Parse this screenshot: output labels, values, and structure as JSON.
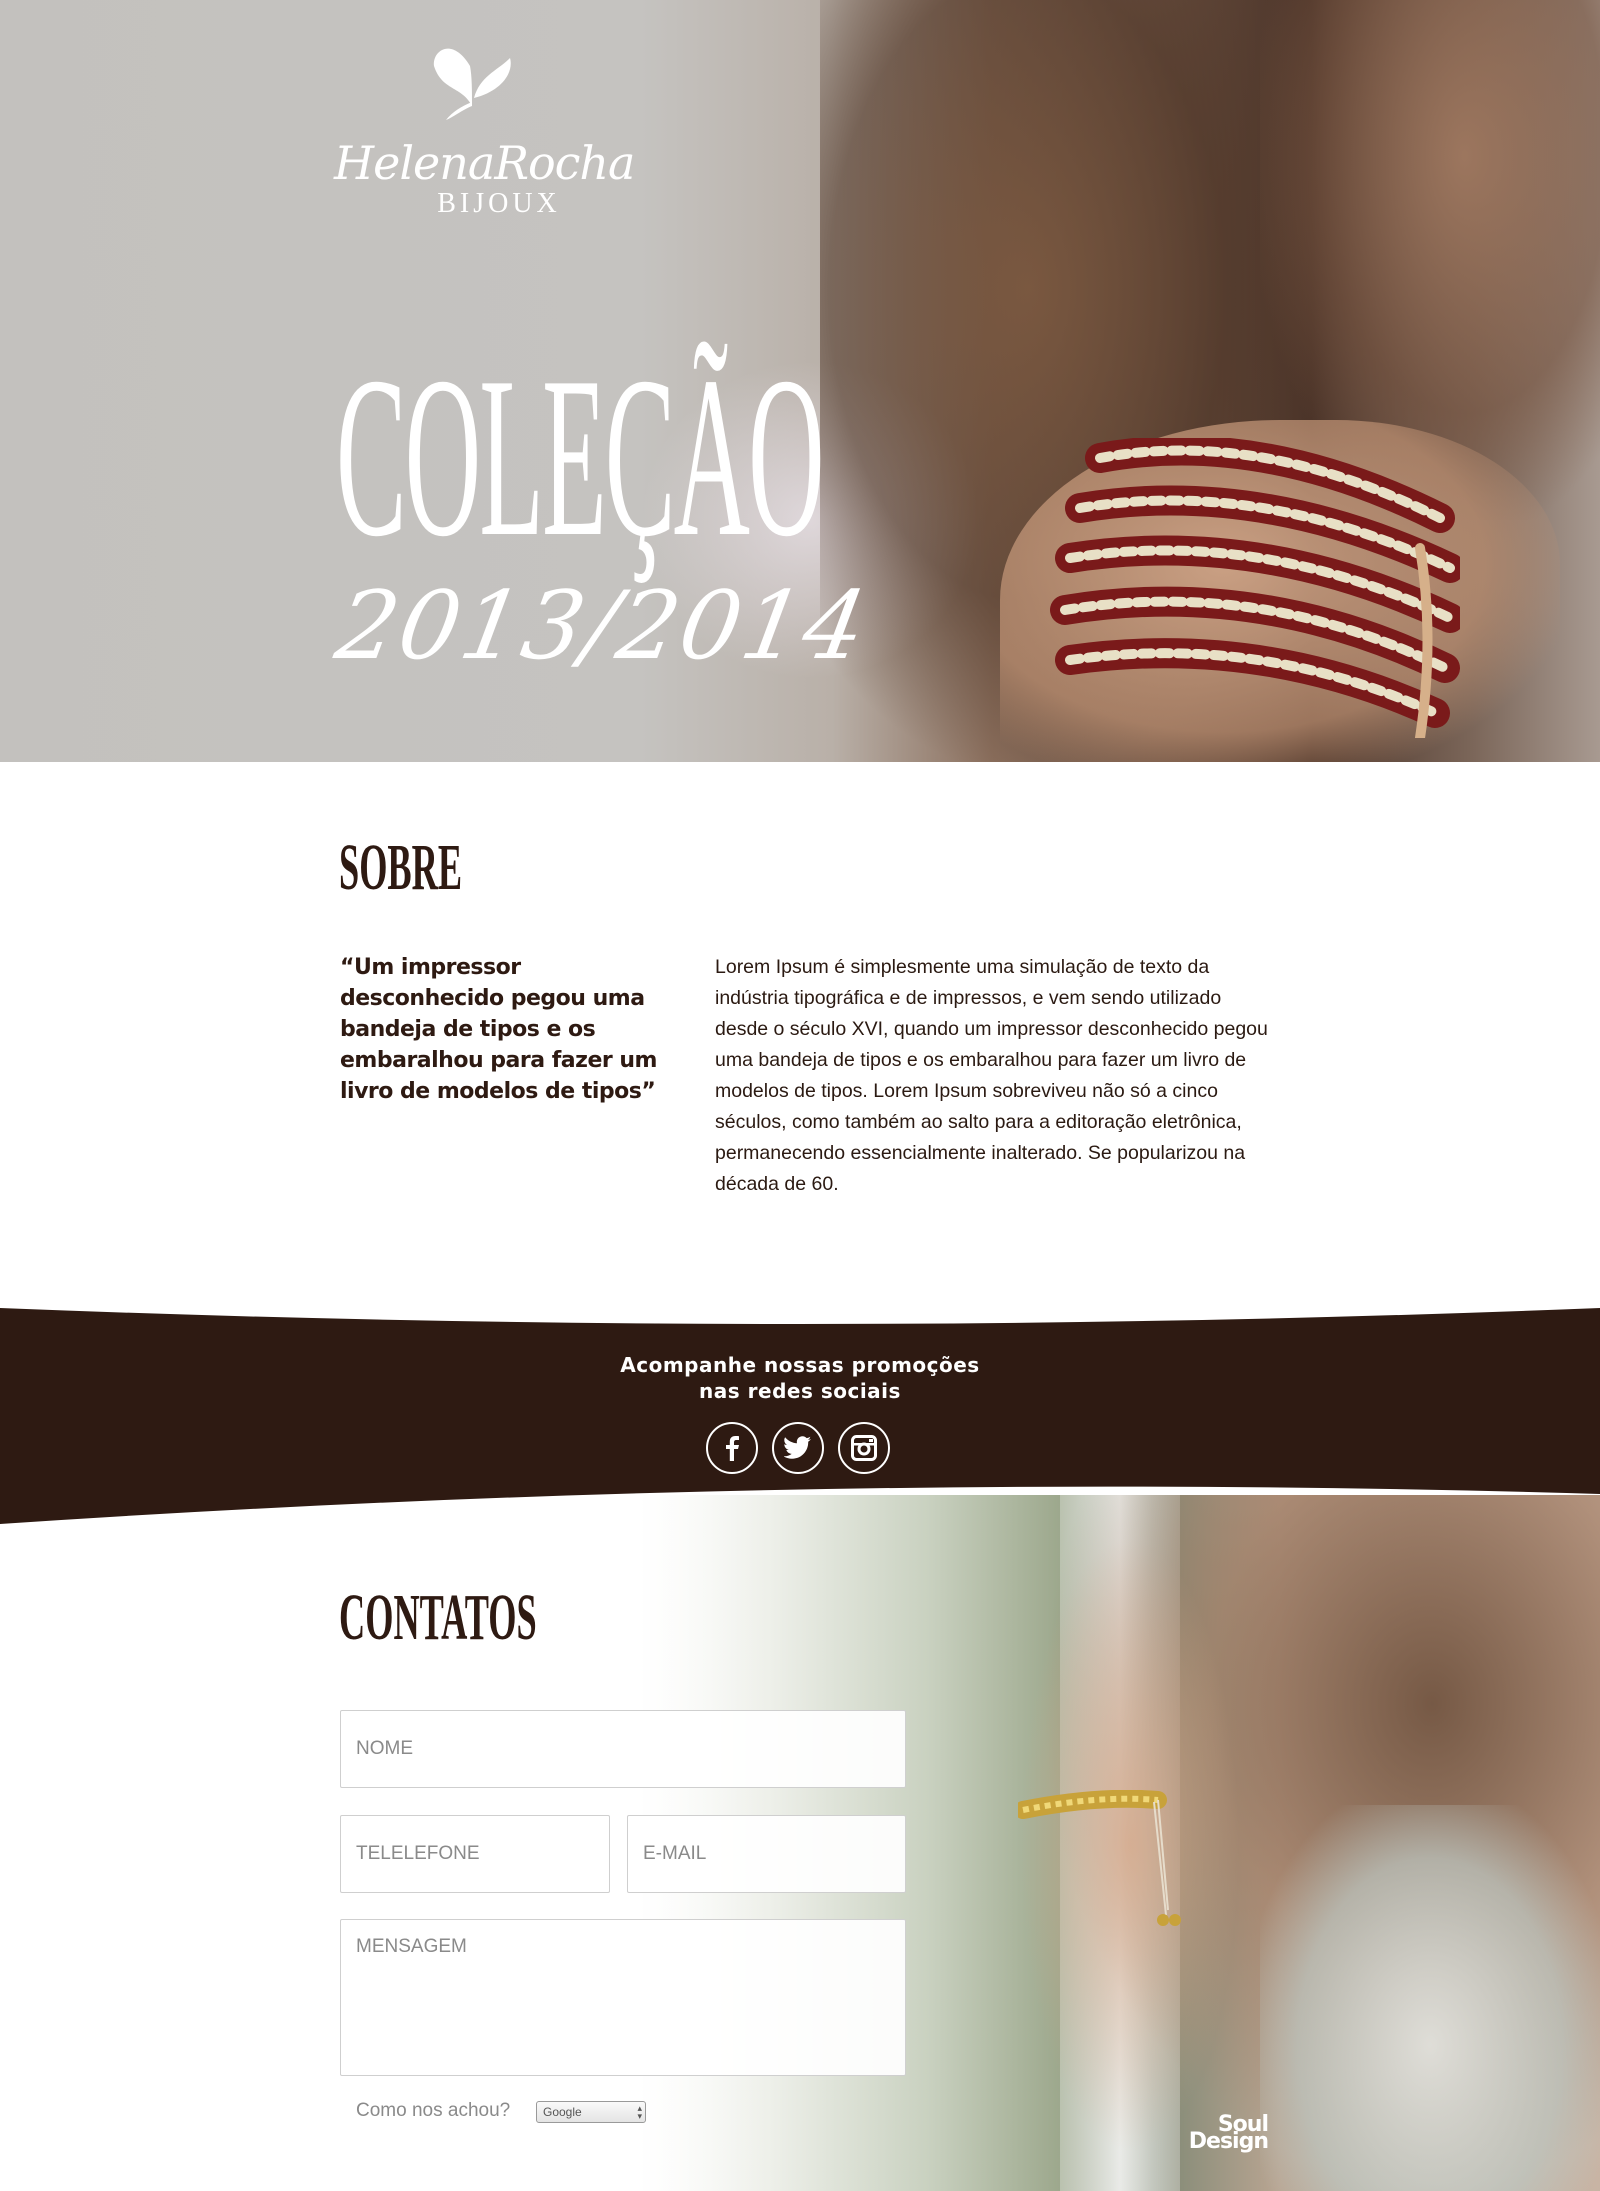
{
  "brand": {
    "name": "HelenaRocha",
    "sub": "BIJOUX"
  },
  "hero": {
    "title": "COLEÇÃO",
    "year": "2013/2014"
  },
  "sobre": {
    "title": "SOBRE",
    "quote": "“Um impressor desconhecido pegou uma bandeja de tipos e os embaralhou para fazer um livro de modelos de tipos”",
    "text": "Lorem Ipsum é simplesmente uma simulação de texto da indústria tipográfica e de impressos, e vem sendo utilizado desde o século XVI, quando um impressor desconhecido pegou uma bandeja de tipos e os embaralhou para fazer um livro de modelos de tipos. Lorem Ipsum sobreviveu não só a cinco séculos, como também ao salto para a editoração eletrônica, permanecendo essencialmente inalterado. Se popularizou na década de 60."
  },
  "social": {
    "line1": "Acompanhe nossas promoções",
    "line2": "nas redes sociais",
    "icons": [
      "facebook-icon",
      "twitter-icon",
      "instagram-icon"
    ]
  },
  "contatos": {
    "title": "CONTATOS",
    "nome_placeholder": "NOME",
    "telefone_placeholder": "TELELEFONE",
    "email_placeholder": "E-MAIL",
    "mensagem_placeholder": "MENSAGEM",
    "found_label": "Como nos achou?",
    "found_value": "Google"
  },
  "credit": {
    "line1": "Soul",
    "line2": "Design"
  },
  "colors": {
    "brown": "#2e1a12",
    "white": "#ffffff",
    "hero_grey": "#c3c1be"
  }
}
